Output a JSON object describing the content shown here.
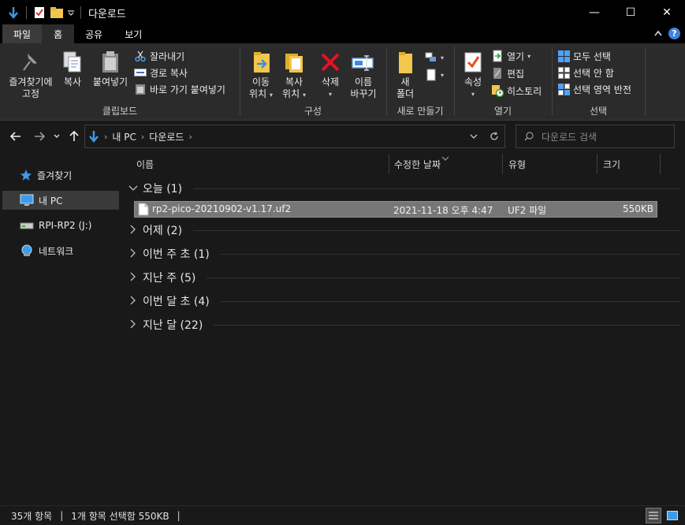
{
  "window": {
    "title": "다운로드",
    "controls": {
      "minimize": "—",
      "maximize": "☐",
      "close": "✕"
    }
  },
  "ribbon_tabs": [
    "파일",
    "홈",
    "공유",
    "보기"
  ],
  "ribbon": {
    "clipboard": {
      "label": "클립보드",
      "pin": [
        "즐겨찾기에",
        "고정"
      ],
      "copy": "복사",
      "paste": "붙여넣기",
      "cut": "잘라내기",
      "copy_path": "경로 복사",
      "paste_shortcut": "바로 가기 붙여넣기"
    },
    "organize": {
      "label": "구성",
      "move_to": [
        "이동",
        "위치"
      ],
      "copy_to": [
        "복사",
        "위치"
      ],
      "delete": "삭제",
      "rename": [
        "이름",
        "바꾸기"
      ]
    },
    "new": {
      "label": "새로 만들기",
      "new_folder": [
        "새",
        "폴더"
      ]
    },
    "open": {
      "label": "열기",
      "properties": "속성",
      "open": "열기",
      "edit": "편집",
      "history": "히스토리"
    },
    "select": {
      "label": "선택",
      "select_all": "모두 선택",
      "select_none": "선택 안 함",
      "invert": "선택 영역 반전"
    }
  },
  "address": {
    "crumbs": [
      "내 PC",
      "다운로드"
    ],
    "search_placeholder": "다운로드 검색"
  },
  "sidebar": {
    "items": [
      {
        "label": "즐겨찾기",
        "icon": "star-icon"
      },
      {
        "label": "내 PC",
        "icon": "pc-icon",
        "selected": true
      },
      {
        "label": "RPI-RP2 (J:)",
        "icon": "drive-icon"
      },
      {
        "label": "네트워크",
        "icon": "network-icon"
      }
    ]
  },
  "columns": [
    "이름",
    "수정한 날짜",
    "유형",
    "크기"
  ],
  "groups": [
    {
      "label": "오늘 (1)",
      "expanded": true
    },
    {
      "label": "어제 (2)",
      "expanded": false
    },
    {
      "label": "이번 주 초 (1)",
      "expanded": false
    },
    {
      "label": "지난 주 (5)",
      "expanded": false
    },
    {
      "label": "이번 달 초 (4)",
      "expanded": false
    },
    {
      "label": "지난 달 (22)",
      "expanded": false
    }
  ],
  "files": [
    {
      "name": "rp2-pico-20210902-v1.17.uf2",
      "date": "2021-11-18 오후 4:47",
      "type": "UF2 파일",
      "size": "550KB"
    }
  ],
  "status": {
    "count": "35개 항목",
    "selection": "1개 항목 선택함 550KB"
  },
  "colors": {
    "accent": "#3d83df",
    "background": "#191919",
    "ribbon": "#2b2b2b",
    "selected_row": "#777777"
  }
}
